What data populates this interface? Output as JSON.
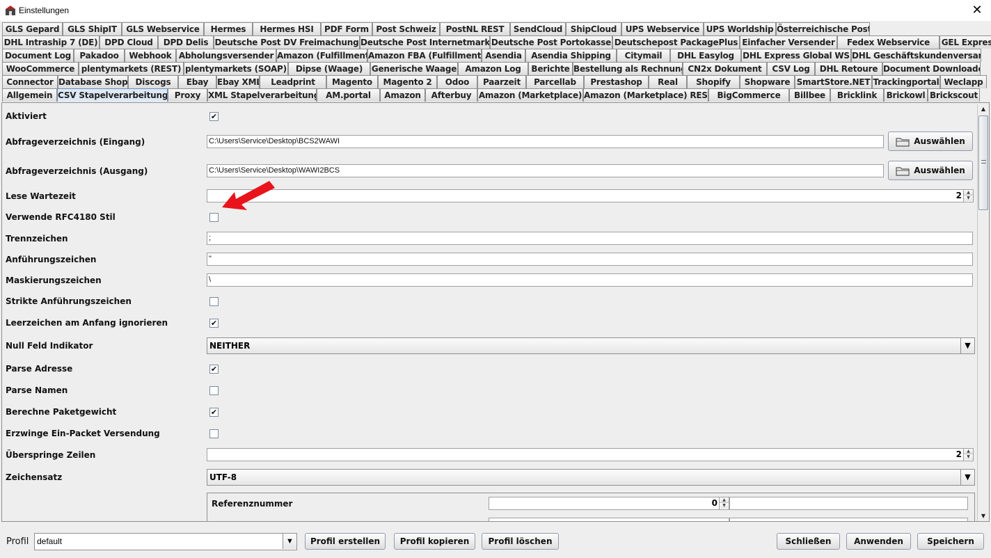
{
  "window": {
    "title": "Einstellungen",
    "close_label": "✕"
  },
  "tabs": {
    "row1": [
      "GLS Gepard",
      "GLS ShipIT",
      "GLS Webservice",
      "Hermes",
      "Hermes HSI",
      "PDF Form",
      "Post Schweiz",
      "PostNL REST",
      "SendCloud",
      "ShipCloud",
      "UPS Webservice",
      "UPS Worldship",
      "Österreichische Post"
    ],
    "row2": [
      "DHL Intraship 7 (DE)",
      "DPD Cloud",
      "DPD Delis",
      "Deutsche Post DV Freimachung",
      "Deutsche Post Internetmarke",
      "Deutsche Post Portokasse",
      "Deutschepost PackagePlus",
      "Einfacher Versender",
      "Fedex Webservice",
      "GEL Express"
    ],
    "row3": [
      "Document Log",
      "Pakadoo",
      "Webhook",
      "Abholungsversender",
      "Amazon (Fulfillment)",
      "Amazon FBA (Fulfillment)",
      "Asendia",
      "Asendia Shipping",
      "Citymail",
      "DHL Easylog",
      "DHL Express Global WS",
      "DHL Geschäftskundenversand"
    ],
    "row4": [
      "WooCommerce",
      "plentymarkets (REST)",
      "plentymarkets (SOAP)",
      "Dipse (Waage)",
      "Generische Waage",
      "Amazon Log",
      "Berichte",
      "Bestellung als Rechnung",
      "CN2x Dokument",
      "CSV Log",
      "DHL Retoure",
      "Document Downloader"
    ],
    "row5": [
      "Connector",
      "Database Shop",
      "Discogs",
      "Ebay",
      "Ebay XML",
      "Leadprint",
      "Magento",
      "Magento 2",
      "Odoo",
      "Paarzeit",
      "Parcellab",
      "Prestashop",
      "Real",
      "Shopify",
      "Shopware",
      "SmartStore.NET",
      "Trackingportal",
      "Weclapp"
    ],
    "row6": [
      "Allgemein",
      "CSV Stapelverarbeitung",
      "Proxy",
      "XML Stapelverarbeitung",
      "AM.portal",
      "Amazon",
      "Afterbuy",
      "Amazon (Marketplace)",
      "Amazon (Marketplace) REST",
      "BigCommerce",
      "Billbee",
      "Bricklink",
      "Brickowl",
      "Brickscout"
    ],
    "active": "CSV Stapelverarbeitung"
  },
  "settings": {
    "aktiviert": {
      "label": "Aktiviert",
      "checked": true
    },
    "abfrage_eingang": {
      "label": "Abfrageverzeichnis (Eingang)",
      "value": "C:\\Users\\Service\\Desktop\\BCS2WAWI",
      "button": "Auswählen"
    },
    "abfrage_ausgang": {
      "label": "Abfrageverzeichnis (Ausgang)",
      "value": "C:\\Users\\Service\\Desktop\\WAWI2BCS",
      "button": "Auswählen"
    },
    "lese_wartezeit": {
      "label": "Lese Wartezeit",
      "value": "2"
    },
    "rfc4180": {
      "label": "Verwende RFC4180 Stil",
      "checked": false
    },
    "trennzeichen": {
      "label": "Trennzeichen",
      "value": ";"
    },
    "anfuehrungszeichen": {
      "label": "Anführungszeichen",
      "value": "\""
    },
    "maskierungszeichen": {
      "label": "Maskierungszeichen",
      "value": "\\"
    },
    "strikte": {
      "label": "Strikte Anführungszeichen",
      "checked": false
    },
    "leerzeichen": {
      "label": "Leerzeichen am Anfang ignorieren",
      "checked": true
    },
    "null_feld": {
      "label": "Null Feld Indikator",
      "value": "NEITHER"
    },
    "parse_adresse": {
      "label": "Parse Adresse",
      "checked": true
    },
    "parse_namen": {
      "label": "Parse Namen",
      "checked": false
    },
    "paketgewicht": {
      "label": "Berechne Paketgewicht",
      "checked": true
    },
    "ein_packet": {
      "label": "Erzwinge Ein-Packet Versendung",
      "checked": false
    },
    "ueberspringe": {
      "label": "Überspringe Zeilen",
      "value": "2"
    },
    "zeichensatz": {
      "label": "Zeichensatz",
      "value": "UTF-8"
    },
    "referenz": {
      "label": "Referenznummer",
      "value": "0"
    }
  },
  "footer": {
    "profil_label": "Profil",
    "profil_value": "default",
    "profil_erstellen": "Profil erstellen",
    "profil_kopieren": "Profil kopieren",
    "profil_loeschen": "Profil löschen",
    "schliessen": "Schließen",
    "anwenden": "Anwenden",
    "speichern": "Speichern"
  },
  "colors": {
    "arrow": "#e8131b",
    "active_tab": "#dfe9f5"
  },
  "icons": {
    "app": "app-icon",
    "folder": "folder-icon",
    "dropdown": "chevron-down-icon"
  }
}
